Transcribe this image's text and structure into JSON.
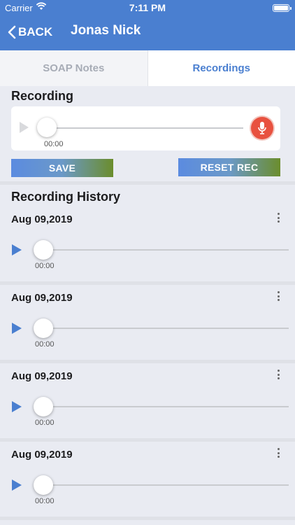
{
  "status_bar": {
    "carrier": "Carrier",
    "time": "7:11 PM"
  },
  "nav": {
    "back_label": "BACK",
    "title": "Jonas Nick"
  },
  "tabs": [
    {
      "label": "SOAP Notes",
      "active": false
    },
    {
      "label": "Recordings",
      "active": true
    }
  ],
  "recording": {
    "title": "Recording",
    "time": "00:00",
    "progress": 0,
    "save_label": "SAVE",
    "reset_label": "RESET REC"
  },
  "history": {
    "title": "Recording History",
    "items": [
      {
        "date": "Aug 09,2019",
        "time": "00:00"
      },
      {
        "date": "Aug 09,2019",
        "time": "00:00"
      },
      {
        "date": "Aug 09,2019",
        "time": "00:00"
      },
      {
        "date": "Aug 09,2019",
        "time": "00:00"
      }
    ]
  },
  "colors": {
    "accent": "#4a7fd0",
    "record": "#e8513f"
  }
}
